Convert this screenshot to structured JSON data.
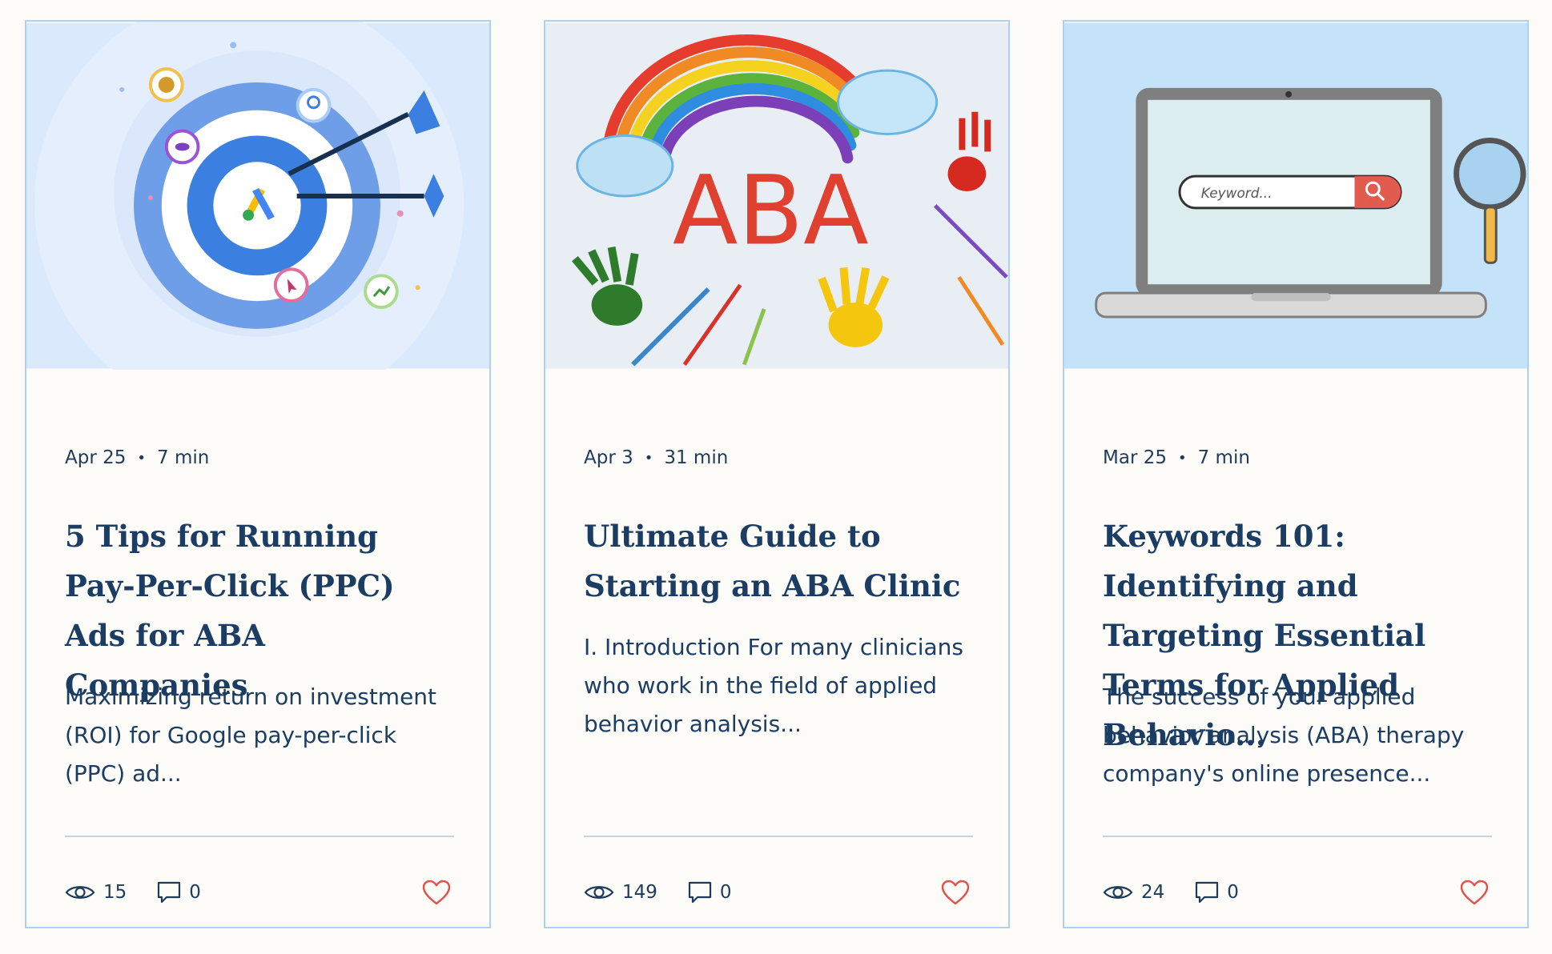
{
  "posts": [
    {
      "date": "Apr 25",
      "read_time": "7 min",
      "title": "5 Tips for Running Pay-Per-Click (PPC) Ads for ABA Companies",
      "excerpt": "Maximizing return on investment (ROI) for Google pay-per-click (PPC) ad...",
      "views": "15",
      "comments": "0",
      "cover_icon": "google-ads-target-illustration"
    },
    {
      "date": "Apr 3",
      "read_time": "31 min",
      "title": "Ultimate Guide to Starting an ABA Clinic",
      "excerpt": "I. Introduction For many clinicians who work in the field of applied behavior analysis...",
      "views": "149",
      "comments": "0",
      "cover_icon": "aba-rainbow-handprints-illustration",
      "cover_text": "ABA"
    },
    {
      "date": "Mar 25",
      "read_time": "7 min",
      "title": "Keywords 101: Identifying and Targeting Essential Terms for Applied Behavio...",
      "excerpt": "The success of your applied behavior analysis (ABA) therapy company's online presence...",
      "views": "24",
      "comments": "0",
      "cover_icon": "laptop-keyword-search-illustration",
      "cover_text": "Keyword..."
    }
  ],
  "separator": "•",
  "colors": {
    "card_border": "#a9d2f3",
    "text": "#1c3d63",
    "heart": "#e0524b",
    "background": "#fdfcf9"
  }
}
